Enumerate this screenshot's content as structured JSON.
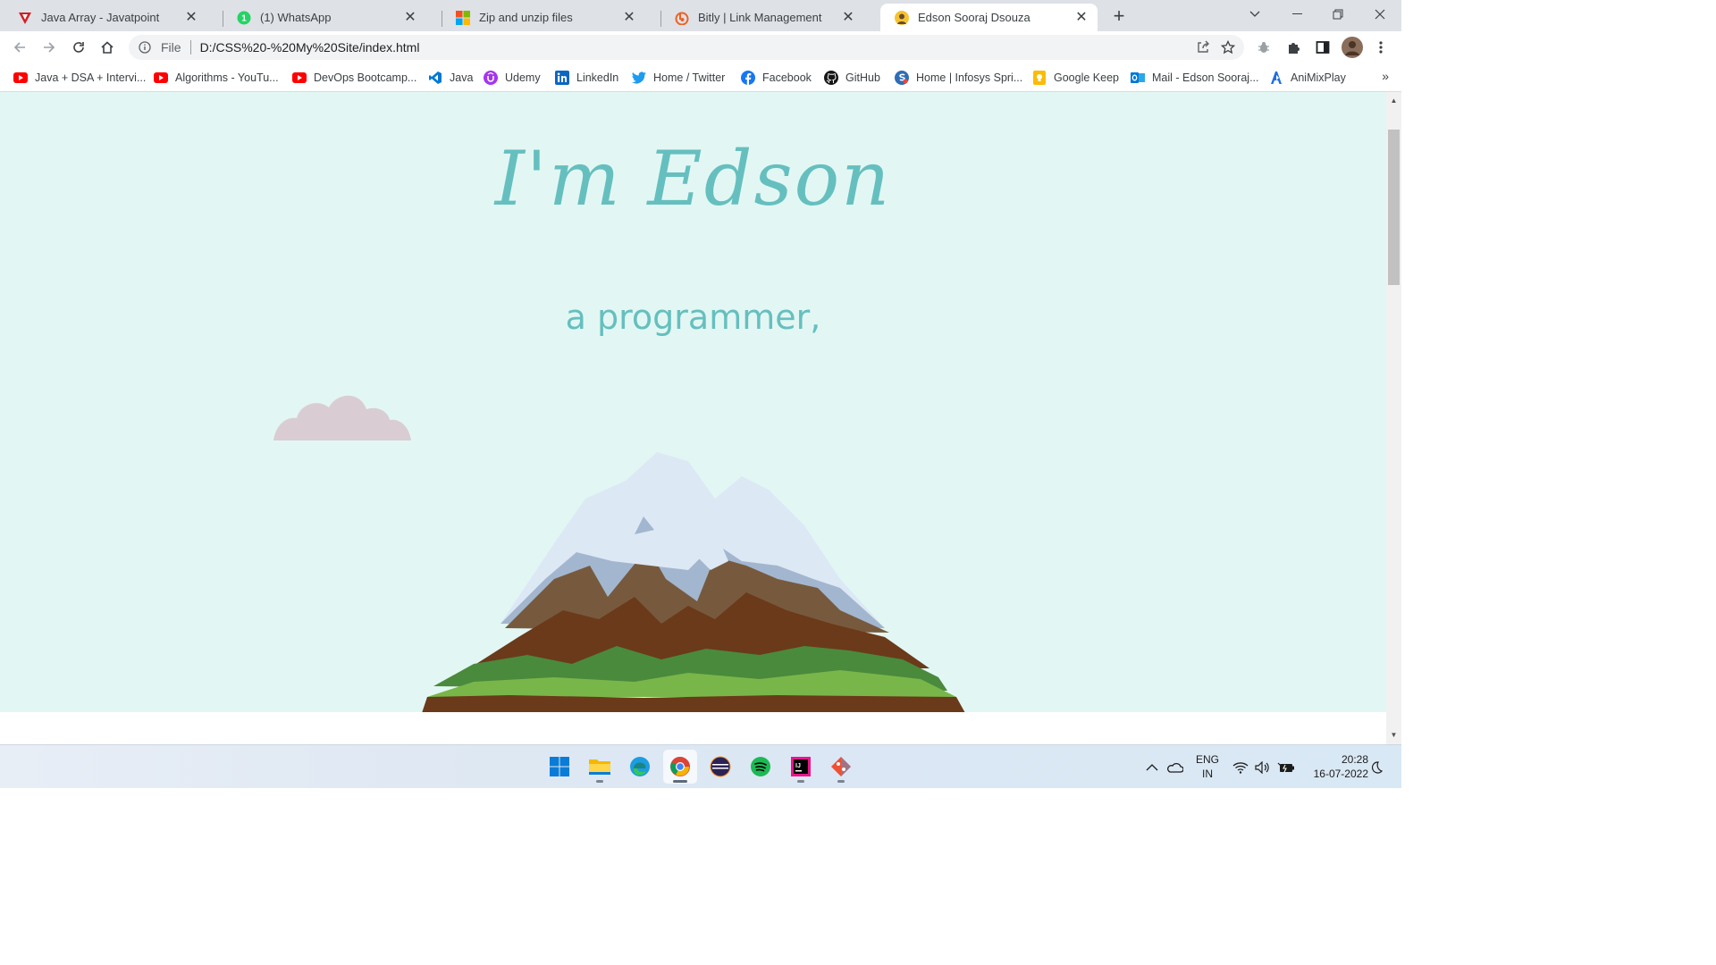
{
  "tabs": [
    {
      "title": "Java Array - Javatpoint",
      "icon": "javatpoint-icon",
      "active": false
    },
    {
      "title": "(1) WhatsApp",
      "icon": "whatsapp-icon",
      "active": false
    },
    {
      "title": "Zip and unzip files",
      "icon": "microsoft-icon",
      "active": false
    },
    {
      "title": "Bitly | Link Management",
      "icon": "bitly-icon",
      "active": false
    },
    {
      "title": "Edson Sooraj Dsouza",
      "icon": "profile-favicon-icon",
      "active": true
    }
  ],
  "whatsapp_badge": "1",
  "address_bar": {
    "scheme_label": "File",
    "url": "D:/CSS%20-%20My%20Site/index.html"
  },
  "bookmarks": [
    {
      "label": "Java + DSA + Intervi...",
      "icon": "youtube-icon"
    },
    {
      "label": "Algorithms - YouTu...",
      "icon": "youtube-icon"
    },
    {
      "label": "DevOps Bootcamp...",
      "icon": "youtube-icon"
    },
    {
      "label": "Java",
      "icon": "vscode-icon"
    },
    {
      "label": "Udemy",
      "icon": "udemy-icon"
    },
    {
      "label": "LinkedIn",
      "icon": "linkedin-icon"
    },
    {
      "label": "Home / Twitter",
      "icon": "twitter-icon"
    },
    {
      "label": "Facebook",
      "icon": "facebook-icon"
    },
    {
      "label": "GitHub",
      "icon": "github-icon"
    },
    {
      "label": "Home | Infosys Spri...",
      "icon": "infosys-icon"
    },
    {
      "label": "Google Keep",
      "icon": "google-keep-icon"
    },
    {
      "label": "Mail - Edson Sooraj...",
      "icon": "outlook-icon"
    },
    {
      "label": "AniMixPlay",
      "icon": "animixplay-icon"
    }
  ],
  "bookmarks_overflow": "»",
  "page": {
    "heading": "I'm Edson",
    "subheading": "a programmer,",
    "background_color": "#e2f7f3",
    "accent_color": "#66bfbf"
  },
  "taskbar": {
    "apps": [
      "start-icon",
      "file-explorer-icon",
      "edge-icon",
      "chrome-icon",
      "eclipse-icon",
      "spotify-icon",
      "intellij-icon",
      "git-icon"
    ],
    "language": "ENG",
    "region": "IN",
    "time": "20:28",
    "date": "16-07-2022"
  }
}
